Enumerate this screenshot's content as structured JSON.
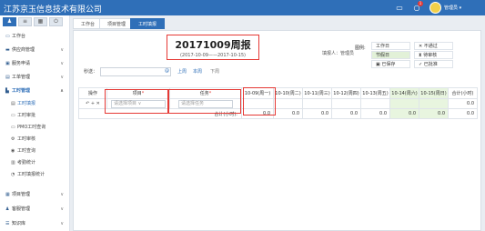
{
  "app": {
    "title": "江苏京玉信息技术有限公司",
    "user": "管理员",
    "notification_count": "1"
  },
  "sidebar": {
    "items": [
      {
        "label": "工作台",
        "icon": "monitor-icon",
        "chev": ""
      },
      {
        "label": "供应商管理",
        "icon": "truck-icon",
        "chev": "∨"
      },
      {
        "label": "服务申请",
        "icon": "inbox-icon",
        "chev": "∨"
      },
      {
        "label": "工单管理",
        "icon": "ticket-icon",
        "chev": "∨"
      },
      {
        "label": "工时管理",
        "icon": "clock-icon",
        "chev": "∧"
      }
    ],
    "sub_items": [
      {
        "label": "工时填报"
      },
      {
        "label": "工时审批"
      },
      {
        "label": "PMO工时查询"
      },
      {
        "label": "工时审核"
      },
      {
        "label": "工时查询"
      },
      {
        "label": "考勤统计"
      },
      {
        "label": "工时填报统计"
      }
    ],
    "bottom_items": [
      {
        "label": "项目管理",
        "chev": "∨"
      },
      {
        "label": "客服管理",
        "chev": "∨"
      },
      {
        "label": "知识库",
        "chev": "∨"
      }
    ]
  },
  "tabs": [
    {
      "label": "工作台"
    },
    {
      "label": "项目管理"
    },
    {
      "label": "工时填报"
    }
  ],
  "report": {
    "title": "20171009周报",
    "period": "(2017-10-09——2017-10-15)",
    "filler": "填报人：管理员"
  },
  "legend": {
    "label": "图例:",
    "workday": "工作日",
    "holiday": "节假日",
    "saved": "已保存",
    "not_passed": "不通过",
    "pending": "待审核",
    "approved": "已批准"
  },
  "search": {
    "label": "秒送：",
    "placeholder": "",
    "prev_week": "上周",
    "this_week": "本周",
    "next_week": "下周"
  },
  "table": {
    "headers": {
      "ops": "操作",
      "project": "项目",
      "task": "任务",
      "days": [
        "10-09(周一)",
        "10-10(周二)",
        "10-11(周三)",
        "10-12(周四)",
        "10-13(周五)",
        "10-14(周六)",
        "10-15(周日)"
      ],
      "total": "合计(小时)"
    },
    "row": {
      "actions": "↶ + ✕",
      "project_placeholder": "请选择项目",
      "task_placeholder": "请选择任务",
      "values": [
        "",
        "",
        "",
        "",
        "",
        "",
        ""
      ],
      "total": "0.0"
    },
    "footer": {
      "label": "合计(小时):",
      "values": [
        "0.0",
        "0.0",
        "0.0",
        "0.0",
        "0.0",
        "0.0",
        "0.0"
      ],
      "total": "0.0"
    }
  },
  "colors": {
    "header": "#2f6fb8",
    "holiday": "#e2f1d8",
    "highlight": "#e53935"
  }
}
